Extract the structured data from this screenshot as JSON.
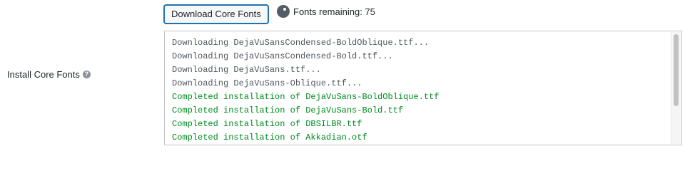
{
  "field": {
    "label": "Install Core Fonts",
    "help_icon": "question-circle-icon"
  },
  "download_button": {
    "label": "Download Core Fonts"
  },
  "status": {
    "icon": "spinner-icon",
    "text": "Fonts remaining: 75"
  },
  "log": {
    "lines": [
      {
        "text": "Downloading DejaVuSansCondensed-BoldOblique.ttf...",
        "type": "downloading"
      },
      {
        "text": "Downloading DejaVuSansCondensed-Bold.ttf...",
        "type": "downloading"
      },
      {
        "text": "Downloading DejaVuSans.ttf...",
        "type": "downloading"
      },
      {
        "text": "Downloading DejaVuSans-Oblique.ttf...",
        "type": "downloading"
      },
      {
        "text": "Completed installation of DejaVuSans-BoldOblique.ttf",
        "type": "completed"
      },
      {
        "text": "Completed installation of DejaVuSans-Bold.ttf",
        "type": "completed"
      },
      {
        "text": "Completed installation of DBSILBR.ttf",
        "type": "completed"
      },
      {
        "text": "Completed installation of Akkadian.otf",
        "type": "completed"
      }
    ]
  },
  "colors": {
    "downloading": "#50575e",
    "completed": "#008a20",
    "button_border": "#2271b1"
  }
}
